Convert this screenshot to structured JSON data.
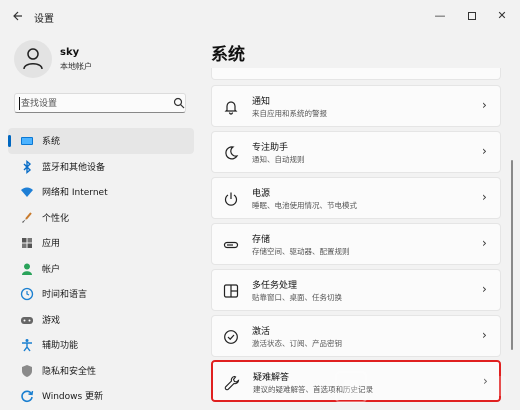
{
  "window": {
    "title": "设置",
    "back_icon": "back-arrow-icon",
    "min_label": "—",
    "close_label": "✕"
  },
  "profile": {
    "name": "sky",
    "account_type": "本地帐户"
  },
  "search": {
    "placeholder": "查找设置"
  },
  "nav": {
    "items": [
      {
        "label": "系统",
        "icon": "system-monitor-icon",
        "active": true
      },
      {
        "label": "蓝牙和其他设备",
        "icon": "bluetooth-icon"
      },
      {
        "label": "网络和 Internet",
        "icon": "wifi-icon"
      },
      {
        "label": "个性化",
        "icon": "brush-icon"
      },
      {
        "label": "应用",
        "icon": "apps-icon"
      },
      {
        "label": "帐户",
        "icon": "account-icon"
      },
      {
        "label": "时间和语言",
        "icon": "globe-clock-icon"
      },
      {
        "label": "游戏",
        "icon": "gamepad-icon"
      },
      {
        "label": "辅助功能",
        "icon": "accessibility-icon"
      },
      {
        "label": "隐私和安全性",
        "icon": "shield-icon"
      },
      {
        "label": "Windows 更新",
        "icon": "update-icon"
      }
    ]
  },
  "main": {
    "title": "系统",
    "cards": [
      {
        "title": "通知",
        "subtitle": "来自应用和系统的警报",
        "icon": "bell-icon"
      },
      {
        "title": "专注助手",
        "subtitle": "通知、自动规则",
        "icon": "moon-icon"
      },
      {
        "title": "电源",
        "subtitle": "睡眠、电池使用情况、节电模式",
        "icon": "power-icon"
      },
      {
        "title": "存储",
        "subtitle": "存储空间、驱动器、配置规则",
        "icon": "drive-icon"
      },
      {
        "title": "多任务处理",
        "subtitle": "贴靠窗口、桌面、任务切换",
        "icon": "multitask-icon"
      },
      {
        "title": "激活",
        "subtitle": "激活状态、订阅、产品密钥",
        "icon": "check-circle-icon"
      },
      {
        "title": "疑难解答",
        "subtitle": "建议的疑难解答、首选项和历史记录",
        "icon": "wrench-icon",
        "highlighted": true
      }
    ]
  },
  "colors": {
    "accent": "#0067c0",
    "highlight_border": "#e02020"
  }
}
